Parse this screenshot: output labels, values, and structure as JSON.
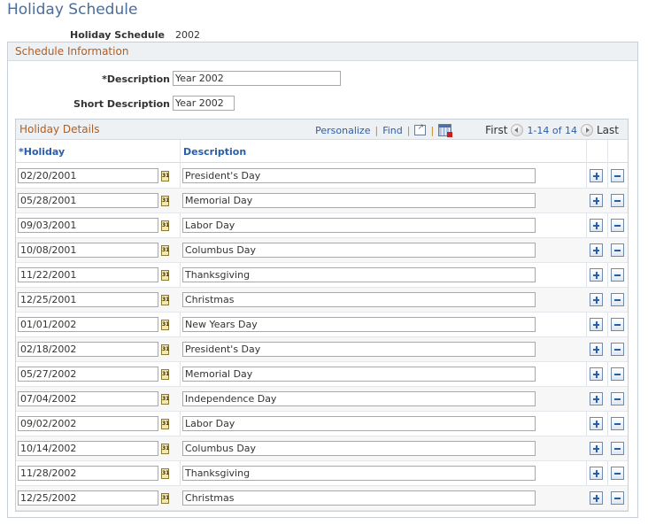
{
  "page": {
    "title": "Holiday Schedule",
    "schedule_label": "Holiday Schedule",
    "schedule_value": "2002"
  },
  "schedule_info": {
    "header": "Schedule Information",
    "description_label": "*Description",
    "description_value": "Year 2002",
    "short_description_label": "Short Description",
    "short_description_value": "Year 2002"
  },
  "grid": {
    "title": "Holiday Details",
    "personalize_label": "Personalize",
    "find_label": "Find",
    "separator": "|",
    "view_all_icon": "zoom-grid-icon",
    "download_icon": "download-to-excel-icon",
    "first_label": "First",
    "range_label": "1-14 of 14",
    "last_label": "Last",
    "columns": {
      "holiday": "*Holiday",
      "description": "Description"
    },
    "rows": [
      {
        "date": "02/20/2001",
        "description": "President's Day"
      },
      {
        "date": "05/28/2001",
        "description": "Memorial Day"
      },
      {
        "date": "09/03/2001",
        "description": "Labor Day"
      },
      {
        "date": "10/08/2001",
        "description": "Columbus Day"
      },
      {
        "date": "11/22/2001",
        "description": "Thanksgiving"
      },
      {
        "date": "12/25/2001",
        "description": "Christmas"
      },
      {
        "date": "01/01/2002",
        "description": "New Years Day"
      },
      {
        "date": "02/18/2002",
        "description": "President's Day"
      },
      {
        "date": "05/27/2002",
        "description": "Memorial Day"
      },
      {
        "date": "07/04/2002",
        "description": "Independence Day"
      },
      {
        "date": "09/02/2002",
        "description": "Labor Day"
      },
      {
        "date": "10/14/2002",
        "description": "Columbus Day"
      },
      {
        "date": "11/28/2002",
        "description": "Thanksgiving"
      },
      {
        "date": "12/25/2002",
        "description": "Christmas"
      }
    ],
    "calendar_icon_text": "31"
  },
  "colors": {
    "title": "#4a6d9c",
    "section_header": "#b45c1e",
    "link": "#2a5ea8",
    "header_bg": "#eef1f4"
  }
}
